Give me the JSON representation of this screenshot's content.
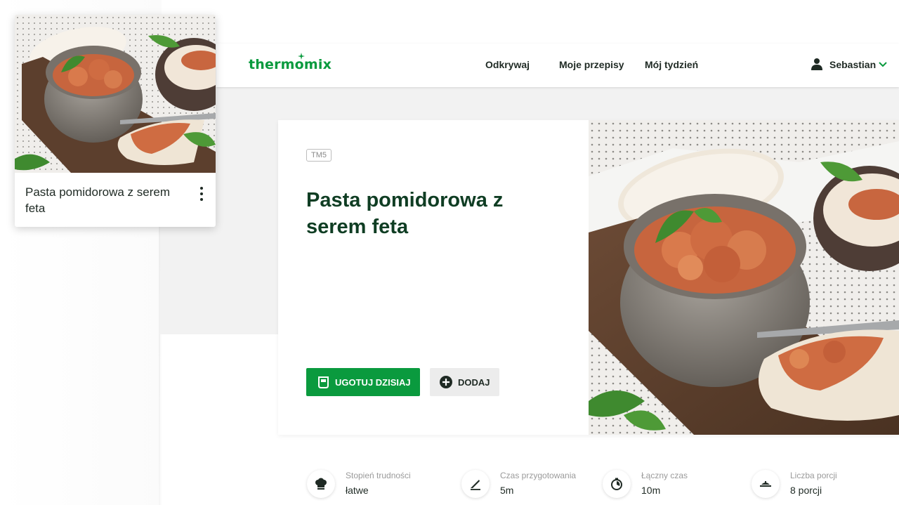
{
  "header": {
    "logo": "thermomix",
    "nav": [
      "Odkrywaj",
      "Moje przepisy",
      "Mój tydzień"
    ],
    "user_name": "Sebastian"
  },
  "hero": {
    "badge": "TM5",
    "title": "Pasta pomidorowa z serem feta",
    "cook_button": "UGOTUJ DZISIAJ",
    "add_button": "DODAJ"
  },
  "floating_card": {
    "title": "Pasta pomidorowa z serem feta"
  },
  "stats": [
    {
      "label": "Stopień trudności",
      "value": "łatwe",
      "icon": "chef-hat-icon"
    },
    {
      "label": "Czas przygotowania",
      "value": "5m",
      "icon": "knife-icon"
    },
    {
      "label": "Łączny czas",
      "value": "10m",
      "icon": "timer-icon"
    },
    {
      "label": "Liczba porcji",
      "value": "8 porcji",
      "icon": "dish-icon"
    }
  ],
  "colors": {
    "brand_green": "#0a9a3e",
    "title_green": "#0f3d23"
  }
}
